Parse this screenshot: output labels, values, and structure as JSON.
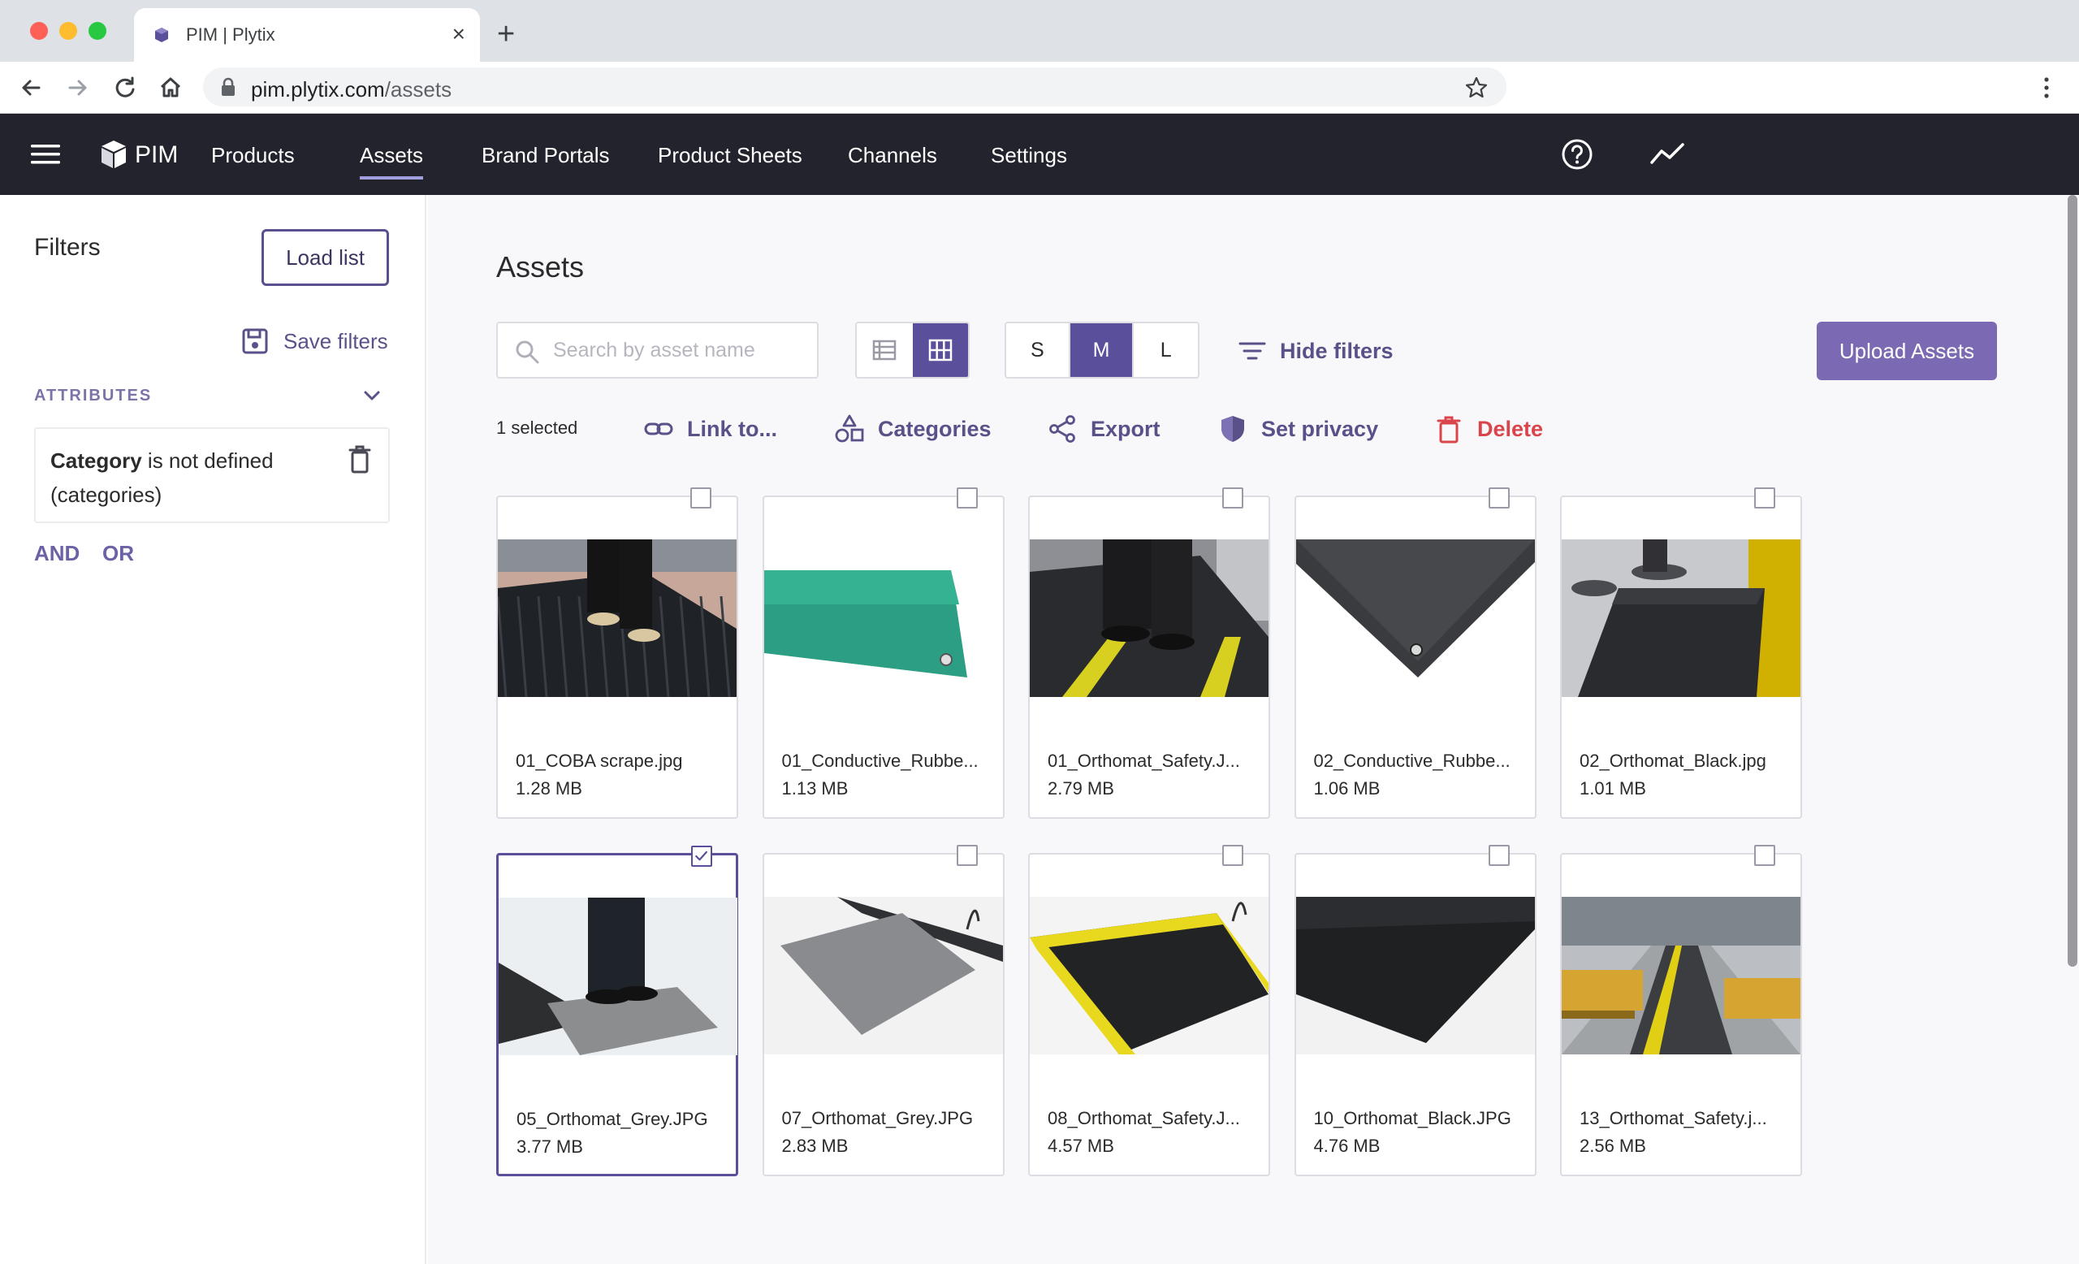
{
  "browser": {
    "tab_title": "PIM | Plytix",
    "url_host": "pim.plytix.com",
    "url_path": "/assets"
  },
  "appbar": {
    "logo_text": "PIM",
    "nav": [
      {
        "label": "Products",
        "active": false
      },
      {
        "label": "Assets",
        "active": true
      },
      {
        "label": "Brand Portals",
        "active": false
      },
      {
        "label": "Product Sheets",
        "active": false
      },
      {
        "label": "Channels",
        "active": false
      },
      {
        "label": "Settings",
        "active": false
      }
    ]
  },
  "sidebar": {
    "title": "Filters",
    "load_list": "Load list",
    "save_filters": "Save filters",
    "attributes_label": "ATTRIBUTES",
    "filter": {
      "field": "Category",
      "condition": " is not defined",
      "detail": "(categories)"
    },
    "and_label": "AND",
    "or_label": "OR"
  },
  "main": {
    "title": "Assets",
    "search_placeholder": "Search by asset name",
    "view_mode": "grid",
    "sizes": [
      {
        "label": "S",
        "active": false
      },
      {
        "label": "M",
        "active": true
      },
      {
        "label": "L",
        "active": false
      }
    ],
    "hide_filters": "Hide filters",
    "upload": "Upload Assets",
    "selected_count": "1 selected",
    "actions": {
      "link": "Link to...",
      "categories": "Categories",
      "export": "Export",
      "privacy": "Set privacy",
      "delete": "Delete"
    },
    "colors": {
      "accent": "#5a4f9a",
      "upload": "#7b6ab3",
      "danger": "#d9454b",
      "nav_bg": "#23232e"
    }
  },
  "assets": [
    {
      "name": "01_COBA scrape.jpg",
      "size": "1.28 MB",
      "selected": false,
      "thumb": "doormat"
    },
    {
      "name": "01_Conductive_Rubbe...",
      "size": "1.13 MB",
      "selected": false,
      "thumb": "green-mat"
    },
    {
      "name": "01_Orthomat_Safety.J...",
      "size": "2.79 MB",
      "selected": false,
      "thumb": "safety-mat-feet"
    },
    {
      "name": "02_Conductive_Rubbe...",
      "size": "1.06 MB",
      "selected": false,
      "thumb": "black-corner"
    },
    {
      "name": "02_Orthomat_Black.jpg",
      "size": "1.01 MB",
      "selected": false,
      "thumb": "black-mat-feet"
    },
    {
      "name": "05_Orthomat_Grey.JPG",
      "size": "3.77 MB",
      "selected": true,
      "thumb": "grey-mat-feet"
    },
    {
      "name": "07_Orthomat_Grey.JPG",
      "size": "2.83 MB",
      "selected": false,
      "thumb": "grey-mat"
    },
    {
      "name": "08_Orthomat_Safety.J...",
      "size": "4.57 MB",
      "selected": false,
      "thumb": "safety-mat"
    },
    {
      "name": "10_Orthomat_Black.JPG",
      "size": "4.76 MB",
      "selected": false,
      "thumb": "black-mat"
    },
    {
      "name": "13_Orthomat_Safety.j...",
      "size": "2.56 MB",
      "selected": false,
      "thumb": "factory-aisle"
    }
  ]
}
